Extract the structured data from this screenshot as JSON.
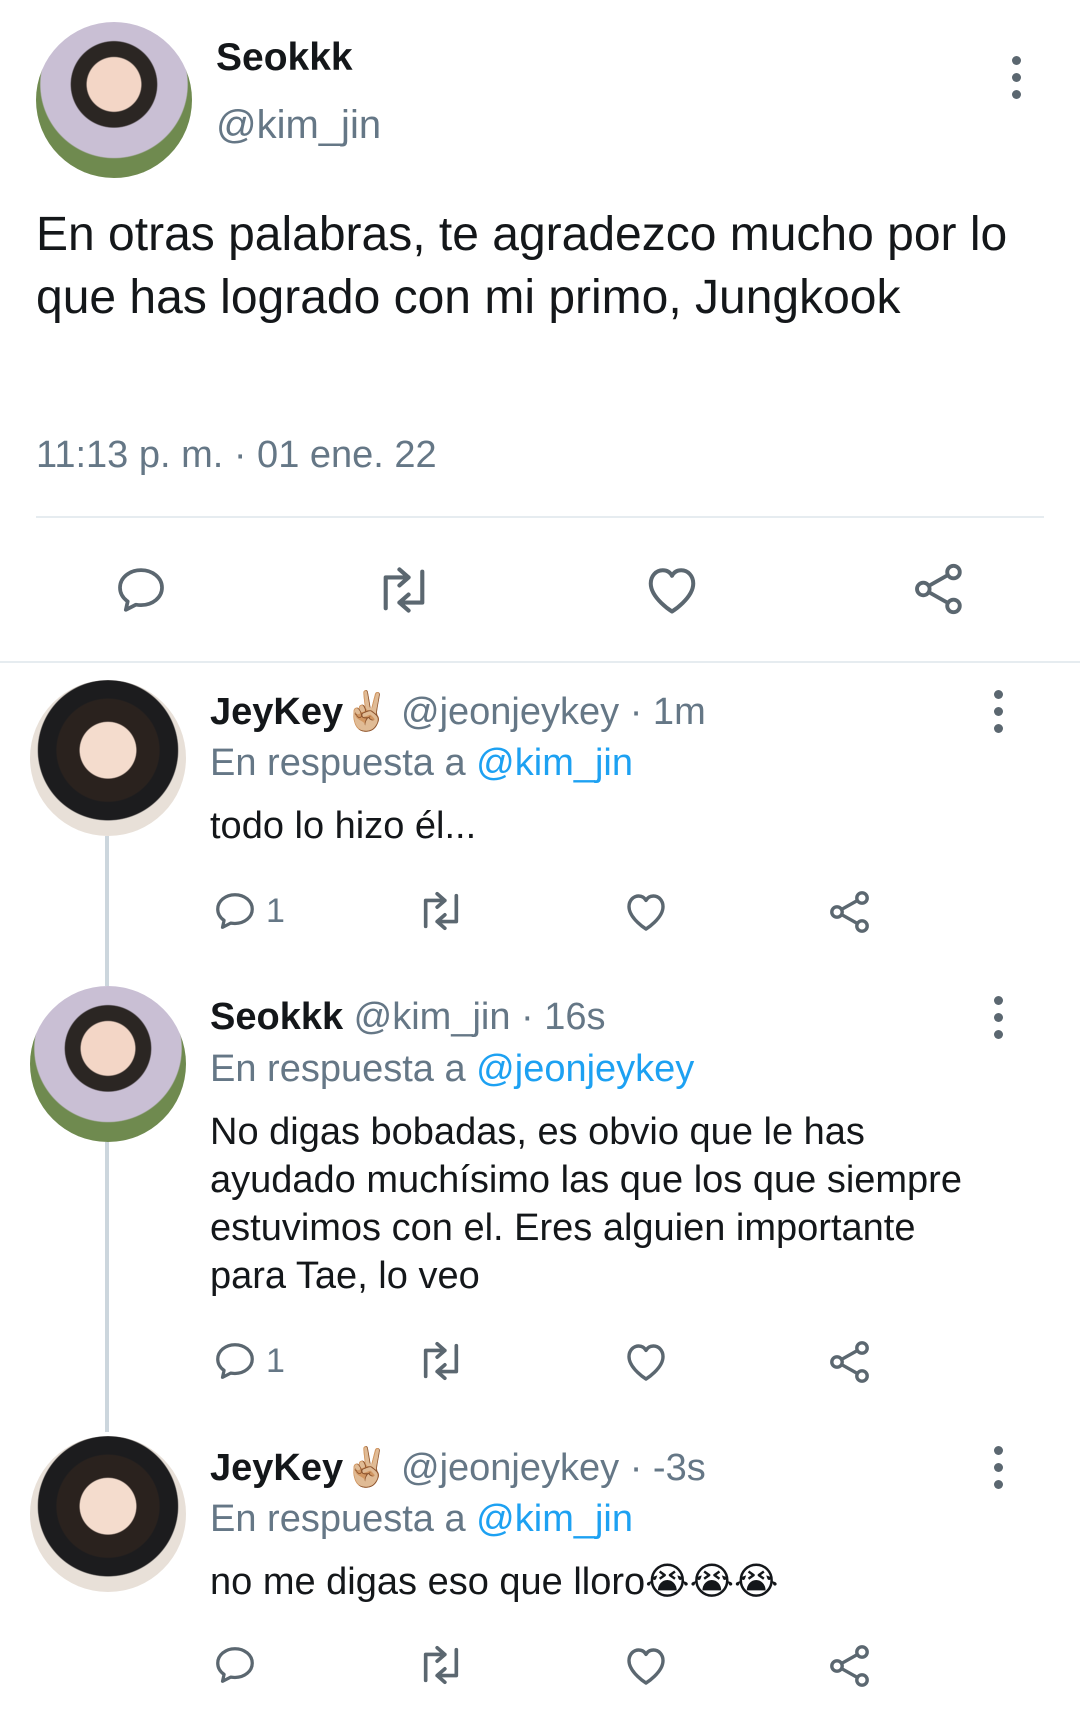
{
  "main_tweet": {
    "name": "Seokkk",
    "handle": "@kim_jin",
    "text": "En otras palabras, te agradezco mucho por lo que has logrado con mi primo, Jungkook",
    "timestamp": "11:13 p. m. · 01 ene. 22",
    "actions": [
      "reply-icon",
      "retweet-icon",
      "like-icon",
      "share-icon"
    ]
  },
  "replies": [
    {
      "name": "JeyKey",
      "emoji": "✌🏼",
      "handle": "@jeonjeykey",
      "time": "· 1m",
      "reply_prefix": "En respuesta a",
      "reply_to": "@kim_jin",
      "text": "todo lo hizo él...",
      "reply_count": "1"
    },
    {
      "name": "Seokkk",
      "emoji": "",
      "handle": "@kim_jin",
      "time": "· 16s",
      "reply_prefix": "En respuesta a",
      "reply_to": "@jeonjeykey",
      "text": "No digas bobadas, es obvio que le has ayudado muchísimo las que los que siempre estuvimos con el. Eres alguien importante para Tae, lo veo",
      "reply_count": "1"
    },
    {
      "name": "JeyKey",
      "emoji": "✌🏼",
      "handle": "@jeonjeykey",
      "time": "· -3s",
      "reply_prefix": "En respuesta a",
      "reply_to": "@kim_jin",
      "text": "no me digas eso que lloro😭😭😭",
      "reply_count": ""
    }
  ],
  "colors": {
    "link": "#1da1f2",
    "secondary_text": "#657786",
    "icon": "#5b6770"
  }
}
